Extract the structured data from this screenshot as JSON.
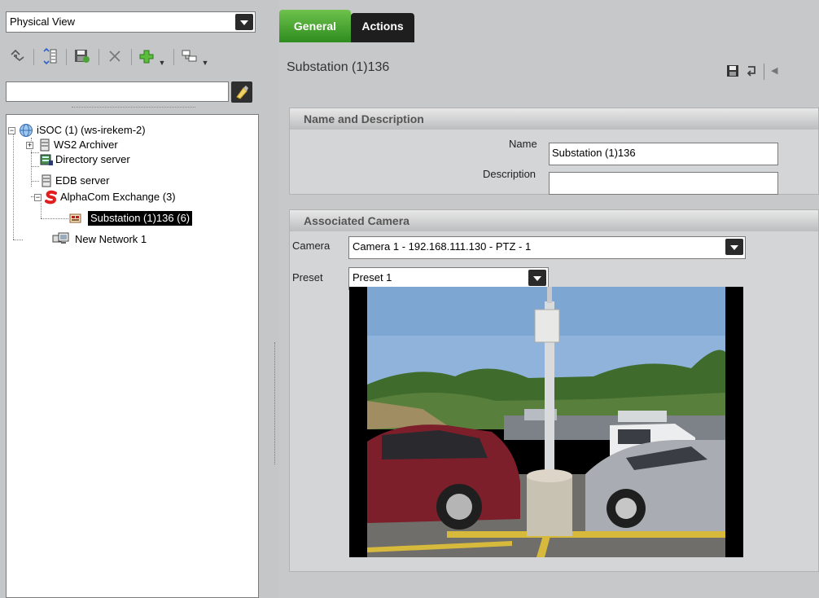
{
  "left_panel": {
    "view_select": "Physical View",
    "search": {
      "value": "",
      "placeholder": ""
    },
    "toolbar_icons": [
      "move-up-down-icon",
      "sort-icon",
      "save-icon",
      "delete-icon",
      "add-icon",
      "filter-icon"
    ],
    "tree": [
      {
        "label": "iSOC (1) (ws-irekem-2)",
        "icon": "globe-icon",
        "expander": "−"
      },
      {
        "label": "WS2 Archiver",
        "icon": "server-icon",
        "expander": "+"
      },
      {
        "label": "Directory server",
        "icon": "directory-server-icon"
      },
      {
        "label": "EDB server",
        "icon": "server-icon"
      },
      {
        "label": "AlphaCom Exchange (3)",
        "icon": "alphacom-icon",
        "expander": "−"
      },
      {
        "label": "Substation (1)136 (6)",
        "icon": "substation-icon",
        "selected": true
      },
      {
        "label": "New Network 1",
        "icon": "network-icon"
      }
    ]
  },
  "tabs": [
    {
      "label": "General",
      "active": true
    },
    {
      "label": "Actions",
      "active": false
    }
  ],
  "title": "Substation (1)136",
  "sections": {
    "name_desc": {
      "header": "Name and Description",
      "name_label": "Name",
      "name_value": "Substation (1)136",
      "description_label": "Description",
      "description_value": ""
    },
    "camera": {
      "header": "Associated Camera",
      "camera_label": "Camera",
      "camera_value": "Camera 1 - 192.168.111.130 - PTZ - 1",
      "preset_label": "Preset",
      "preset_value": "Preset 1"
    }
  },
  "colors": {
    "tab_active": "#4aa832",
    "tab_inactive": "#1e1e1e",
    "selection": "#000000"
  }
}
